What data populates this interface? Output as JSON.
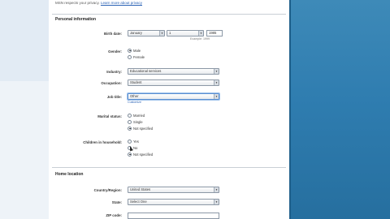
{
  "privacy": {
    "text": "MSN respects your privacy.",
    "link": "Learn more about privacy"
  },
  "personal": {
    "title": "Personal information",
    "birth_date": {
      "label": "Birth date:",
      "month": "January",
      "day": "1",
      "year": "1985",
      "year_hint": "Example: 1999"
    },
    "gender": {
      "label": "Gender:",
      "options": [
        {
          "label": "Male",
          "selected": true
        },
        {
          "label": "Female",
          "selected": false
        }
      ]
    },
    "industry": {
      "label": "Industry:",
      "value": "Educational services"
    },
    "occupation": {
      "label": "Occupation:",
      "value": "Student"
    },
    "job_title": {
      "label": "Job title:",
      "value": "Other",
      "hint": "Customize"
    },
    "marital": {
      "label": "Marital status:",
      "options": [
        {
          "label": "Married",
          "selected": false
        },
        {
          "label": "Single",
          "selected": false
        },
        {
          "label": "Not specified",
          "selected": true
        }
      ]
    },
    "children": {
      "label": "Children in household:",
      "options": [
        {
          "label": "Yes",
          "selected": false
        },
        {
          "label": "No",
          "selected": false
        },
        {
          "label": "Not specified",
          "selected": true
        }
      ]
    }
  },
  "home": {
    "title": "Home location",
    "country": {
      "label": "Country/Region:",
      "value": "United States"
    },
    "state": {
      "label": "State:",
      "value": "Select One"
    },
    "zip": {
      "label": "ZIP code:",
      "value": ""
    }
  },
  "icons": {
    "select_arrow": "chevron-down-icon",
    "cursor": "mouse-cursor-icon"
  },
  "colors": {
    "panel": "#2f7db0",
    "link": "#2a62b5",
    "focus": "#5b8fd1"
  }
}
